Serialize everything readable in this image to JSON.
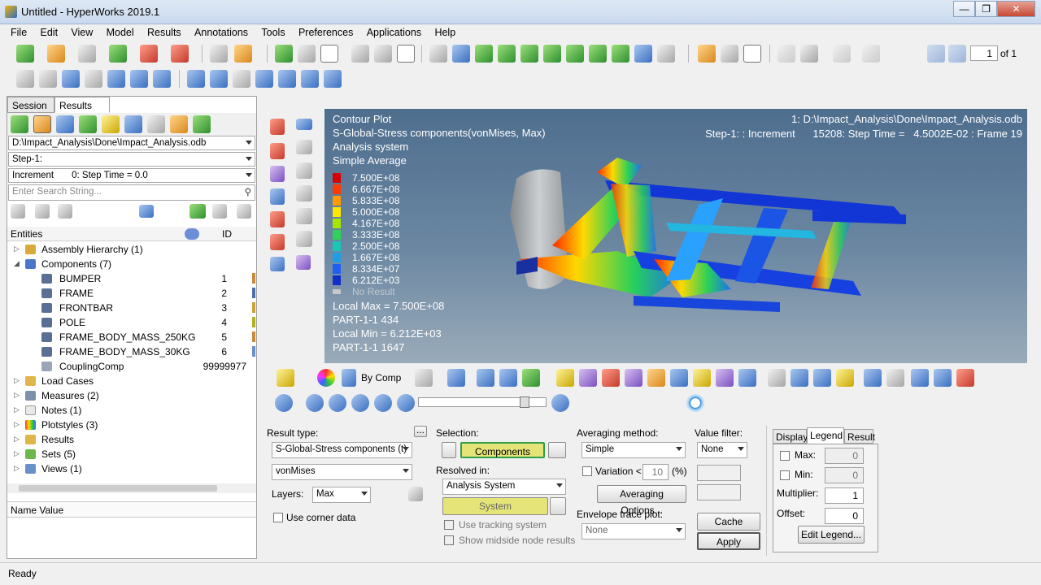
{
  "window": {
    "title": "Untitled - HyperWorks 2019.1",
    "minimize": "—",
    "restore": "❐",
    "close": "✕"
  },
  "menu": [
    "File",
    "Edit",
    "View",
    "Model",
    "Results",
    "Annotations",
    "Tools",
    "Preferences",
    "Applications",
    "Help"
  ],
  "page_nav": {
    "current": "1",
    "of": "of 1"
  },
  "left": {
    "tabs": {
      "session": "Session",
      "results": "Results",
      "close": "✕"
    },
    "file_path": "D:\\Impact_Analysis\\Done\\Impact_Analysis.odb",
    "step": "Step-1:",
    "increment_label": "Increment",
    "increment_value": "0: Step Time = 0.0",
    "search_placeholder": "Enter Search String...",
    "entities_header": "Entities",
    "id_header": "ID",
    "tree": [
      {
        "label": "Assembly Hierarchy (1)",
        "toggle": "▷",
        "id": ""
      },
      {
        "label": "Components (7)",
        "toggle": "◢",
        "id": ""
      },
      {
        "label": "BUMPER",
        "toggle": "",
        "id": "1"
      },
      {
        "label": "FRAME",
        "toggle": "",
        "id": "2"
      },
      {
        "label": "FRONTBAR",
        "toggle": "",
        "id": "3"
      },
      {
        "label": "POLE",
        "toggle": "",
        "id": "4"
      },
      {
        "label": "FRAME_BODY_MASS_250KG",
        "toggle": "",
        "id": "5"
      },
      {
        "label": "FRAME_BODY_MASS_30KG",
        "toggle": "",
        "id": "6"
      },
      {
        "label": "CouplingComp",
        "toggle": "",
        "id": "99999977"
      },
      {
        "label": "Load Cases",
        "toggle": "▷",
        "id": ""
      },
      {
        "label": "Measures (2)",
        "toggle": "▷",
        "id": ""
      },
      {
        "label": "Notes (1)",
        "toggle": "▷",
        "id": ""
      },
      {
        "label": "Plotstyles (3)",
        "toggle": "▷",
        "id": ""
      },
      {
        "label": "Results",
        "toggle": "▷",
        "id": ""
      },
      {
        "label": "Sets (5)",
        "toggle": "▷",
        "id": ""
      },
      {
        "label": "Views (1)",
        "toggle": "▷",
        "id": ""
      }
    ],
    "name_value_header": "Name Value"
  },
  "viewport": {
    "title": "Contour Plot",
    "result": "S-Global-Stress components(vonMises, Max)",
    "system": "Analysis system",
    "averaging": "Simple Average",
    "file": "1: D:\\Impact_Analysis\\Done\\Impact_Analysis.odb",
    "step_info": "Step-1: : Increment      15208: Step Time =   4.5002E-02 : Frame 19",
    "legend": [
      {
        "value": "7.500E+08",
        "color": "#d60000"
      },
      {
        "value": "6.667E+08",
        "color": "#ff3a00"
      },
      {
        "value": "5.833E+08",
        "color": "#ff9a00"
      },
      {
        "value": "5.000E+08",
        "color": "#ffe600"
      },
      {
        "value": "4.167E+08",
        "color": "#a8e600"
      },
      {
        "value": "3.333E+08",
        "color": "#2fd15a"
      },
      {
        "value": "2.500E+08",
        "color": "#19c7b5"
      },
      {
        "value": "1.667E+08",
        "color": "#1f9ee6"
      },
      {
        "value": "8.334E+07",
        "color": "#1f5ff0"
      },
      {
        "value": "6.212E+03",
        "color": "#1030c8"
      }
    ],
    "no_result": "No Result",
    "local_max": "Local Max =  7.500E+08",
    "max_part": "PART-1-1 434",
    "local_min": "Local Min =  6.212E+03",
    "min_part": "PART-1-1 1647"
  },
  "toolbar_lower": {
    "by_comp": "By Comp"
  },
  "panel": {
    "result_type_label": "Result type:",
    "result_type": "S-Global-Stress components (t)",
    "component": "vonMises",
    "layers_label": "Layers:",
    "layers": "Max",
    "corner_data": "Use corner data",
    "selection_label": "Selection:",
    "selection_value": "Components",
    "resolved_label": "Resolved in:",
    "resolved_value": "Analysis System",
    "system_btn": "System",
    "tracking": "Use tracking system",
    "midside": "Show midside node results",
    "averaging_label": "Averaging method:",
    "averaging_value": "Simple",
    "variation_label": "Variation <",
    "variation_value": "10",
    "variation_unit": "(%)",
    "averaging_options": "Averaging Options...",
    "envelope_label": "Envelope trace plot:",
    "envelope_value": "None",
    "value_filter_label": "Value filter:",
    "value_filter": "None",
    "cache": "Cache",
    "apply": "Apply",
    "tabs": {
      "display": "Display",
      "legend": "Legend",
      "result": "Result"
    },
    "max_label": "Max:",
    "max_value": "0",
    "min_label": "Min:",
    "min_value": "0",
    "multiplier_label": "Multiplier:",
    "multiplier_value": "1",
    "offset_label": "Offset:",
    "offset_value": "0",
    "edit_legend": "Edit Legend...",
    "dots": "..."
  },
  "status": "Ready"
}
